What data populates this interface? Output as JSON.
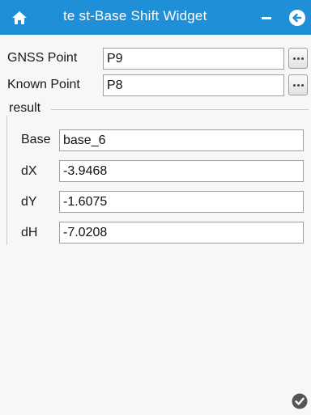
{
  "header": {
    "title": "te st-Base Shift Widget",
    "home_icon": "home-icon",
    "minimize_icon": "minimize-icon",
    "back_icon": "back-arrow-icon",
    "color": "#1f8fd8"
  },
  "gnss": {
    "label": "GNSS Point",
    "value": "P9",
    "browse_icon": "more-icon"
  },
  "known": {
    "label": "Known Point",
    "value": "P8",
    "browse_icon": "more-icon"
  },
  "result": {
    "title": "result",
    "base": {
      "label": "Base",
      "value": "base_6"
    },
    "dx": {
      "label": "dX",
      "value": "-3.9468"
    },
    "dy": {
      "label": "dY",
      "value": "-1.6075"
    },
    "dh": {
      "label": "dH",
      "value": "-7.0208"
    }
  },
  "footer": {
    "confirm_icon": "checkmark-icon"
  }
}
